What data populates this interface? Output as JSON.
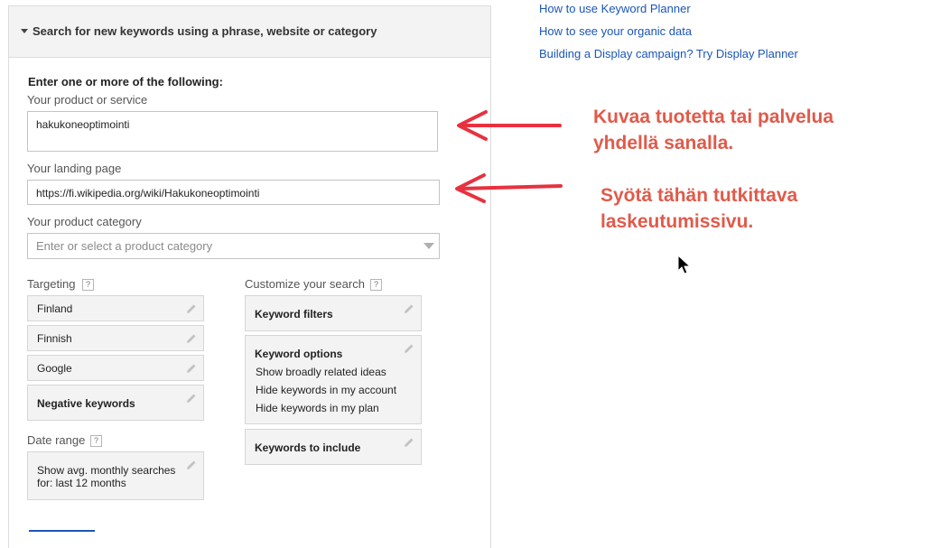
{
  "header": {
    "title": "Search for new keywords using a phrase, website or category"
  },
  "form": {
    "intro": "Enter one or more of the following:",
    "product_label": "Your product or service",
    "product_value": "hakukoneoptimointi",
    "landing_label": "Your landing page",
    "landing_value": "https://fi.wikipedia.org/wiki/Hakukoneoptimointi",
    "category_label": "Your product category",
    "category_placeholder": "Enter or select a product category"
  },
  "targeting": {
    "label": "Targeting",
    "help": "?",
    "location": "Finland",
    "language": "Finnish",
    "network": "Google",
    "negative": "Negative keywords"
  },
  "date_range": {
    "label": "Date range",
    "help": "?",
    "value_line1": "Show avg. monthly searches",
    "value_line2": "for: last 12 months"
  },
  "customize": {
    "label": "Customize your search",
    "help": "?",
    "filters": "Keyword filters",
    "options_title": "Keyword options",
    "options": [
      "Show broadly related ideas",
      "Hide keywords in my account",
      "Hide keywords in my plan"
    ],
    "include": "Keywords to include"
  },
  "links": [
    "How to use Keyword Planner",
    "How to see your organic data",
    "Building a Display campaign? Try Display Planner"
  ],
  "annotations": {
    "first_line1": "Kuvaa tuotetta tai palvelua",
    "first_line2": "yhdellä sanalla.",
    "second_line1": "Syötä tähän tutkittava",
    "second_line2": "laskeutumissivu."
  },
  "colors": {
    "link": "#1a56b7",
    "annotation": "#e05a4a",
    "arrow": "#e8313f"
  }
}
